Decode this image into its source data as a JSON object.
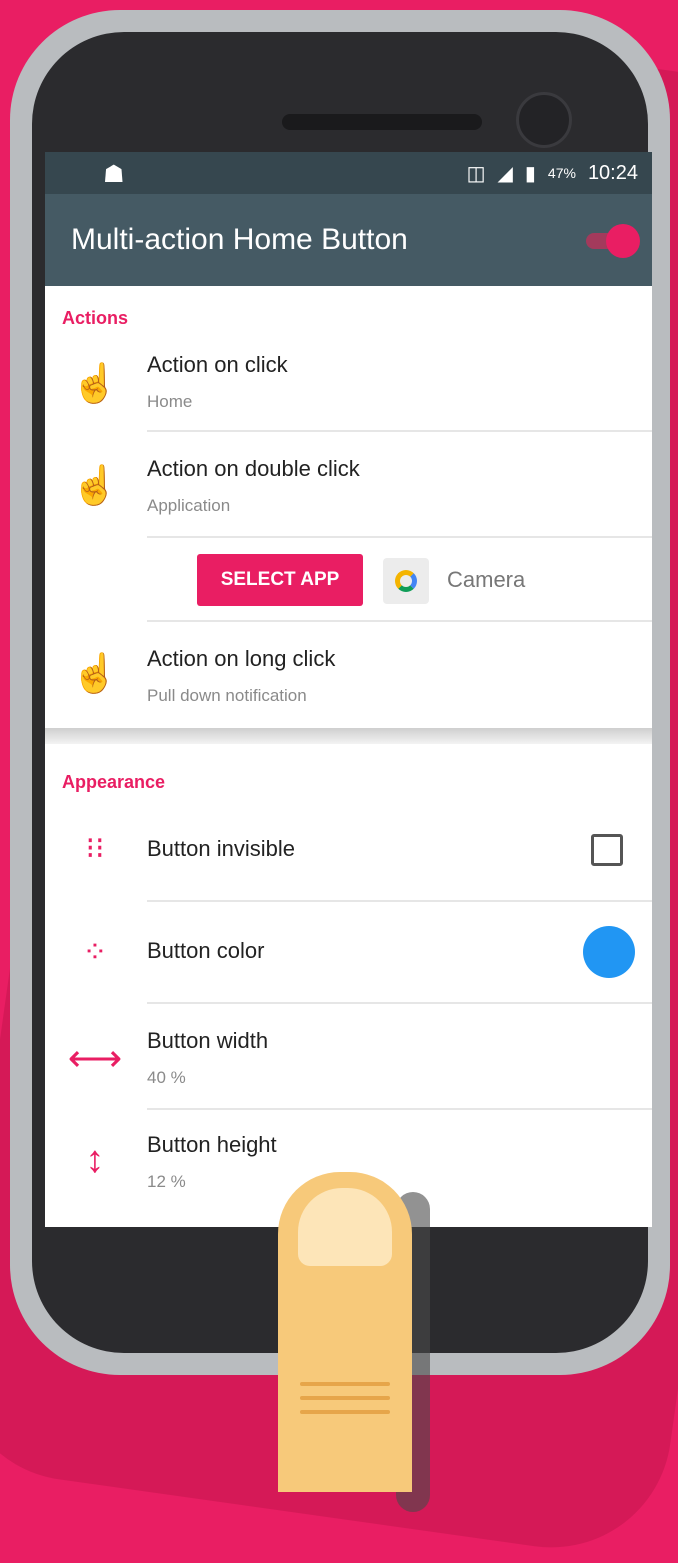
{
  "status_bar": {
    "battery": "47%",
    "time": "10:24"
  },
  "app_bar": {
    "title": "Multi-action Home Button",
    "enabled": true
  },
  "actions": {
    "title": "Actions",
    "click": {
      "label": "Action on click",
      "value": "Home"
    },
    "double_click": {
      "label": "Action on double click",
      "value": "Application"
    },
    "select_app": {
      "button": "SELECT APP",
      "app_name": "Camera"
    },
    "long_click": {
      "label": "Action on long click",
      "value": "Pull down notification"
    }
  },
  "appearance": {
    "title": "Appearance",
    "invisible": {
      "label": "Button invisible",
      "checked": false
    },
    "color": {
      "label": "Button color",
      "value": "#2196f3"
    },
    "width": {
      "label": "Button width",
      "value": "40 %"
    },
    "height": {
      "label": "Button height",
      "value": "12 %"
    }
  },
  "colors": {
    "accent": "#e91e63",
    "toolbar": "#455a64",
    "status": "#36474f"
  },
  "icons": [
    "android-icon",
    "vibrate-icon",
    "signal-icon",
    "battery-icon",
    "tap-hand-icon",
    "double-tap-hand-icon",
    "long-press-hand-icon",
    "camera-app-icon",
    "invisible-grid-icon",
    "color-dots-icon",
    "horizontal-arrows-icon",
    "vertical-arrows-icon"
  ]
}
